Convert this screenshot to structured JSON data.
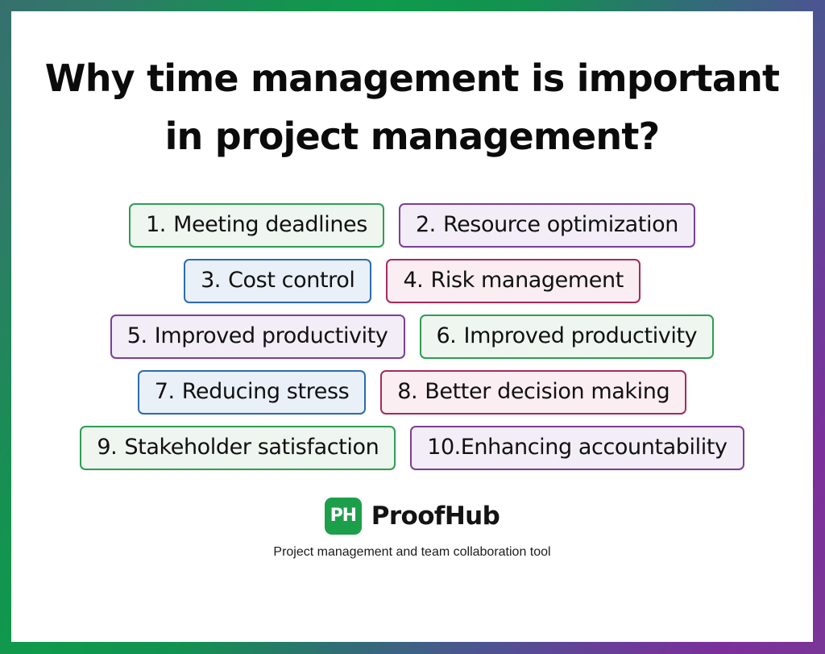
{
  "title": {
    "line1": "Why time management is important",
    "line2": "in project management?"
  },
  "colors": {
    "green_border": "#2e9e54",
    "green_fill": "#eef6ef",
    "purple_border": "#7b3f98",
    "purple_fill": "#f2edf6",
    "blue_border": "#2b6cb0",
    "blue_fill": "#eaf0f8",
    "crimson_border": "#a82a5a",
    "crimson_fill": "#fbeef2",
    "brand_green": "#1d9e4b",
    "frame_gradient_start": "#36706e",
    "frame_gradient_mid": "#0f9a4c",
    "frame_gradient_end": "#7b2f9a"
  },
  "reasons": [
    {
      "num": "1.",
      "label": "Meeting deadlines",
      "color": "green"
    },
    {
      "num": "2.",
      "label": "Resource optimization",
      "color": "purple"
    },
    {
      "num": "3.",
      "label": "Cost control",
      "color": "blue"
    },
    {
      "num": "4.",
      "label": "Risk management",
      "color": "crimson"
    },
    {
      "num": "5.",
      "label": "Improved productivity",
      "color": "purple"
    },
    {
      "num": "6.",
      "label": "Improved productivity",
      "color": "green"
    },
    {
      "num": "7.",
      "label": "Reducing stress",
      "color": "blue"
    },
    {
      "num": "8.",
      "label": "Better decision making",
      "color": "crimson"
    },
    {
      "num": "9.",
      "label": "Stakeholder satisfaction",
      "color": "green"
    },
    {
      "num": "10.",
      "label": "Enhancing accountability",
      "color": "purple"
    }
  ],
  "footer": {
    "logo_mark_text": "PH",
    "brand_name": "ProofHub",
    "tagline": "Project management and team collaboration tool"
  }
}
